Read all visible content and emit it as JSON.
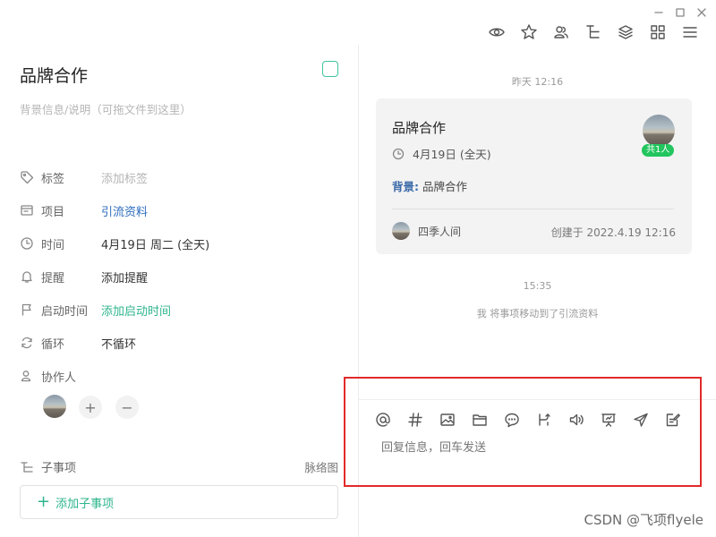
{
  "window": {
    "controls": [
      "minimize",
      "maximize",
      "close"
    ]
  },
  "toolbar": {
    "icons": [
      "eye-icon",
      "star-icon",
      "members-icon",
      "tree-icon",
      "layers-icon",
      "apps-icon",
      "menu-icon"
    ]
  },
  "task": {
    "title": "品牌合作",
    "description_placeholder": "背景信息/说明（可拖文件到这里）"
  },
  "fields": [
    {
      "label": "标签",
      "value": "添加标签",
      "style": "muted",
      "icon": "tag-icon"
    },
    {
      "label": "项目",
      "value": "引流资料",
      "style": "link",
      "icon": "project-icon"
    },
    {
      "label": "时间",
      "value": "4月19日 周二 (全天)",
      "style": "normal",
      "icon": "clock-icon"
    },
    {
      "label": "提醒",
      "value": "添加提醒",
      "style": "normal",
      "icon": "bell-icon"
    },
    {
      "label": "启动时间",
      "value": "添加启动时间",
      "style": "green",
      "icon": "flag-icon"
    },
    {
      "label": "循环",
      "value": "不循环",
      "style": "normal",
      "icon": "repeat-icon"
    }
  ],
  "collaborators": {
    "label": "协作人",
    "add": "+",
    "remove": "−"
  },
  "subtasks": {
    "label": "子事项",
    "mindmap": "脉络图",
    "add_label": "添加子事项",
    "add_icon": "+"
  },
  "timeline": {
    "first_timestamp": "昨天 12:16",
    "card": {
      "title": "品牌合作",
      "date": "4月19日 (全天)",
      "background_label": "背景:",
      "background_value": "品牌合作",
      "owner": "四季人间",
      "created": "创建于 2022.4.19 12:16",
      "badge": "共1人"
    },
    "second_timestamp": "15:35",
    "event_text": "我 将事项移动到了引流资料"
  },
  "reply": {
    "placeholder": "回复信息，回车发送",
    "tools": [
      "at-icon",
      "hashtag-icon",
      "image-icon",
      "folder-icon",
      "comment-icon",
      "branch-icon",
      "voice-icon",
      "presentation-icon",
      "send-icon",
      "edit-note-icon"
    ]
  },
  "watermark": "CSDN @飞项flyele",
  "colors": {
    "accent_green": "#2fb58e",
    "link_blue": "#2d6cbf",
    "highlight_red": "#e22a2a",
    "badge_green": "#22c55e"
  }
}
